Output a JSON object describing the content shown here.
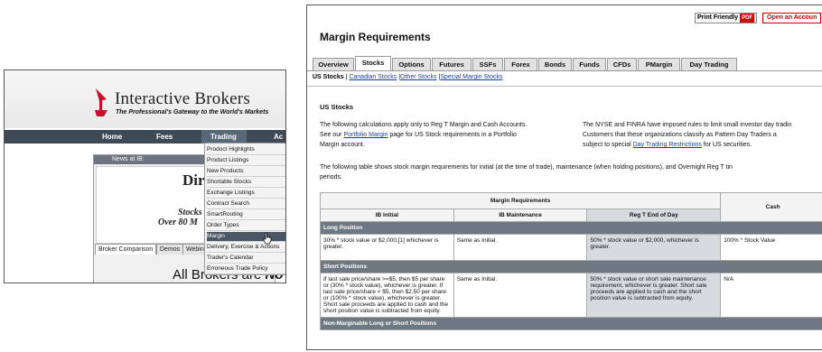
{
  "left": {
    "brand_name": "Interactive Brokers",
    "tagline": "The Professional's Gateway to the World's Markets",
    "nav": [
      "Home",
      "Fees",
      "Trading",
      "Ac"
    ],
    "news_label": "News at IB:",
    "headline": "Dir",
    "promo_line1": "Stocks",
    "promo_line2": "Over 80 M",
    "tabs": [
      "Broker Comparison",
      "Demos",
      "Webin"
    ],
    "banner": "All Brokers are",
    "banner_end": "No",
    "dropdown": [
      "Product Highlights",
      "Product Listings",
      "New Products",
      "Shortable Stocks",
      "Exchange Listings",
      "Contract Search",
      "SmartRouting",
      "Order Types",
      "Margin",
      "Delivery, Exercise & Actions",
      "Trader's Calendar",
      "Erroneous Trade Policy"
    ],
    "dropdown_selected": "Margin"
  },
  "right": {
    "print_friendly": "Print Friendly",
    "pdf": "PDF",
    "open_account": "Open an Accoun",
    "title": "Margin Requirements",
    "tabs": [
      "Overview",
      "Stocks",
      "Options",
      "Futures",
      "SSFs",
      "Forex",
      "Bonds",
      "Funds",
      "CFDs",
      "PMargin",
      "Day Trading"
    ],
    "active_tab": "Stocks",
    "subnav": [
      "US Stocks",
      "Canadian Stocks",
      "Other Stocks",
      "Special Margin Stocks"
    ],
    "section": "US Stocks",
    "para1a": "The following calculations apply only to Reg T Margin and Cash Accounts.",
    "para1b_pre": "See our",
    "para1b_link": "Portfolio Margin",
    "para1b_post": "page for US Stock requirements in a Portfolio",
    "para1c": "Margin account.",
    "para2a": "The NYSE and FINRA have imposed rules to limit small investor day tradin",
    "para2b": "Customers that these organizations classify as Pattern Day Traders a",
    "para2c_pre": "subject to special",
    "para2c_link": "Day Trading Restrictions",
    "para2c_post": "for US securities.",
    "para3a": "The following table shows stock margin requirements for initial (at the time of trade), maintenance (when holding positions), and Overnight Reg T tin",
    "para3b": "periods.",
    "table": {
      "group_header": "Margin Requirements",
      "cols": [
        "IB Initial",
        "IB Maintenance",
        "Reg T End of Day",
        "Cash"
      ],
      "sections": [
        {
          "name": "Long Position",
          "cells": [
            "30% * stock value or $2,000,[1] whichever is greater.",
            "Same as Initial.",
            "50% * stock value or $2,000, whichever is greater.",
            "100% * Stock Value"
          ]
        },
        {
          "name": "Short Positions",
          "cells": [
            "If last sale price/share >=$5, then $5 per share or (30% * stock value), whichever is greater. If last sale price/share < $5, then $2.50 per share or (100% * stock value), whichever is greater. Short sale proceeds are applied to cash and the short position value is subtracted from equity.",
            "Same as Initial.",
            "50% * stock value or short sale maintenance requirement, whichever is greater. Short sale proceeds are applied to cash and the short position value is subtracted from equity.",
            "N/A"
          ]
        },
        {
          "name": "Non-Marginable Long or Short Positions",
          "cells": []
        }
      ]
    }
  },
  "colors": {
    "nav_bg": "#3e4a56",
    "band_bg": "#6e7882",
    "link": "#1a3fa0",
    "pdf_red": "#dd0000"
  }
}
